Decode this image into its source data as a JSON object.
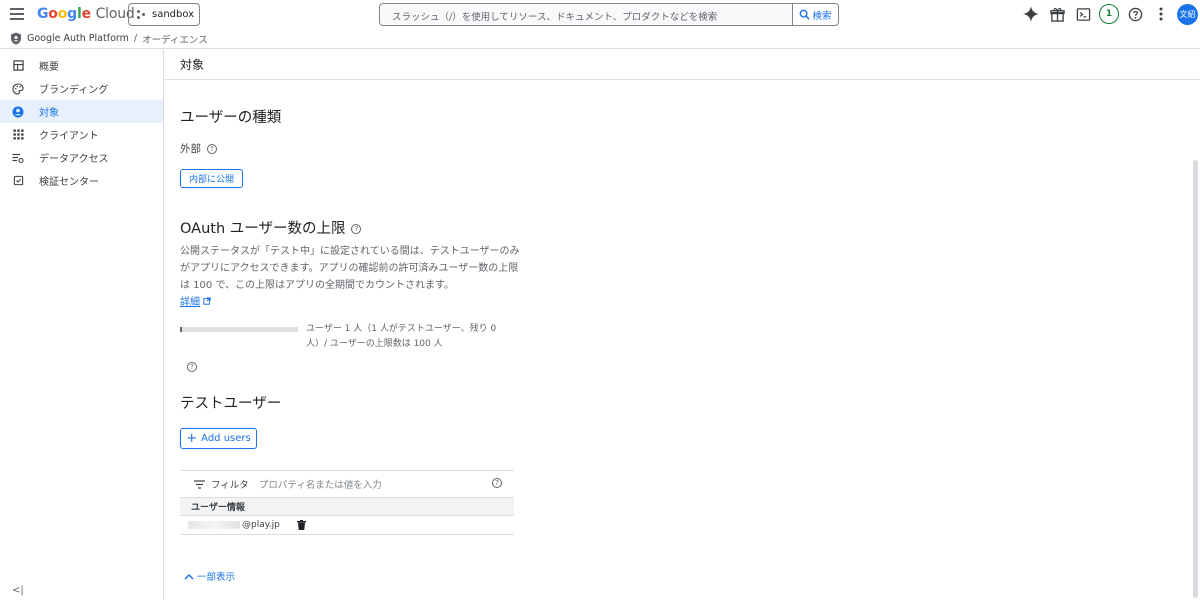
{
  "header": {
    "logo_google": "Google",
    "logo_cloud": "Cloud",
    "project": "sandbox",
    "search_placeholder": "スラッシュ（/）を使用してリソース、ドキュメント、プロダクトなどを検索",
    "search_button": "検索",
    "notification_count": "1",
    "avatar_initials": "文紹"
  },
  "breadcrumb": {
    "root": "Google Auth Platform",
    "separator": "/",
    "current": "オーディエンス"
  },
  "sidebar": {
    "items": [
      {
        "label": "概要",
        "icon": "dashboard-icon"
      },
      {
        "label": "ブランディング",
        "icon": "palette-icon"
      },
      {
        "label": "対象",
        "icon": "account-circle-icon"
      },
      {
        "label": "クライアント",
        "icon": "apps-grid-icon"
      },
      {
        "label": "データアクセス",
        "icon": "data-access-icon"
      },
      {
        "label": "検証センター",
        "icon": "verification-icon"
      }
    ],
    "active_index": 2,
    "collapse_label": "<|"
  },
  "page": {
    "title": "対象",
    "user_type": {
      "heading": "ユーザーの種類",
      "value": "外部",
      "make_internal_button": "内部に公開"
    },
    "oauth_limit": {
      "heading": "OAuth ユーザー数の上限",
      "description": "公開ステータスが「テスト中」に設定されている間は、テストユーザーのみがアプリにアクセスできます。アプリの確認前の許可済みユーザー数の上限は 100 で、この上限はアプリの全期間でカウントされます。",
      "learn_more": "詳細",
      "usage_text": "ユーザー 1 人（1 人がテストユーザー、残り 0 人）/ ユーザーの上限数は 100 人",
      "usage_fraction": 0.01
    },
    "test_users": {
      "heading": "テストユーザー",
      "add_button": "Add users",
      "filter_label": "フィルタ",
      "filter_placeholder": "プロパティ名または値を入力",
      "column_header": "ユーザー情報",
      "rows": [
        {
          "email_suffix": "@play.jp"
        }
      ]
    },
    "show_less": "一部表示"
  },
  "colors": {
    "accent": "#1a73e8",
    "active_nav_bg": "#e8f0fe",
    "badge_green": "#188038"
  }
}
